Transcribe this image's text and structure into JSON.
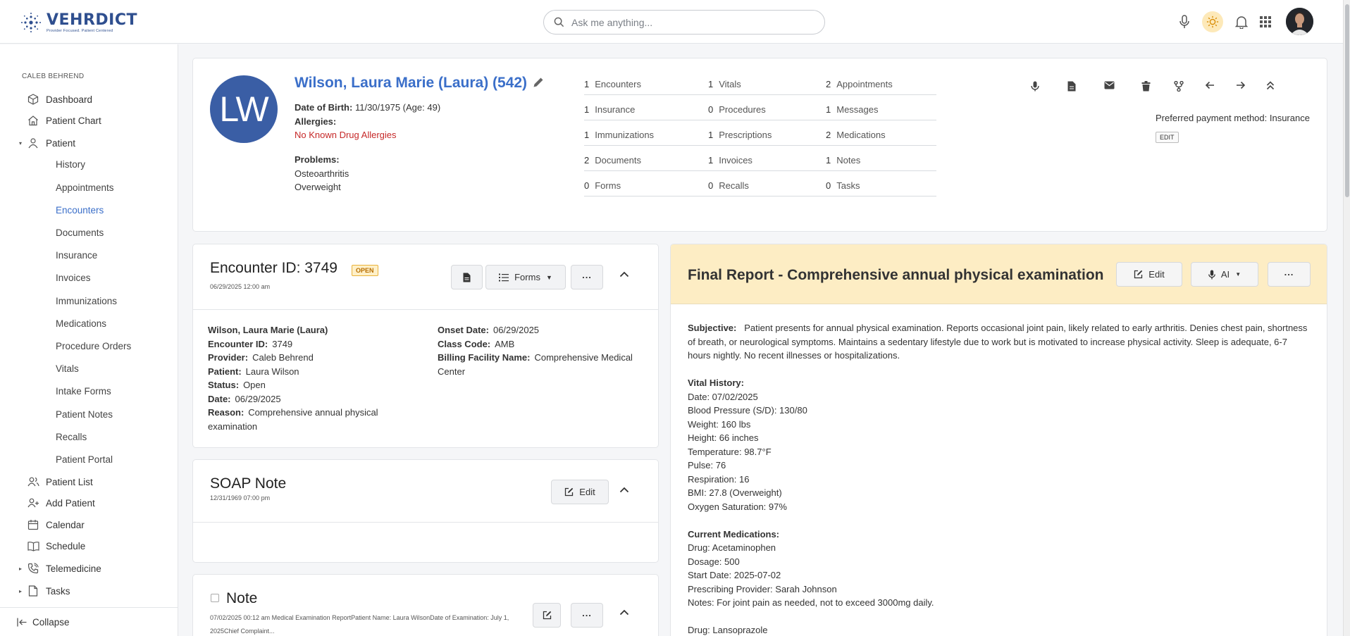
{
  "header": {
    "logo_name": "VEHRDICT",
    "logo_tagline": "Provider Focused. Patient Centered",
    "search_placeholder": "Ask me anything...",
    "icons": [
      "microphone-icon",
      "sun-icon",
      "bell-icon",
      "apps-grid-icon"
    ]
  },
  "sidebar": {
    "user": "CALEB BEHREND",
    "items": [
      {
        "label": "Dashboard",
        "icon": "cube-icon"
      },
      {
        "label": "Patient Chart",
        "icon": "home-icon"
      },
      {
        "label": "Patient",
        "icon": "user-icon"
      },
      {
        "label": "Patient List",
        "icon": "users-icon"
      },
      {
        "label": "Add Patient",
        "icon": "user-plus-icon"
      },
      {
        "label": "Calendar",
        "icon": "calendar-icon"
      },
      {
        "label": "Schedule",
        "icon": "book-icon"
      },
      {
        "label": "Telemedicine",
        "icon": "phone-icon"
      },
      {
        "label": "Tasks",
        "icon": "file-icon"
      }
    ],
    "patient_sub": [
      "History",
      "Appointments",
      "Encounters",
      "Documents",
      "Insurance",
      "Invoices",
      "Immunizations",
      "Medications",
      "Procedure Orders",
      "Vitals",
      "Intake Forms",
      "Patient Notes",
      "Recalls",
      "Patient Portal"
    ],
    "active_sub": "Encounters",
    "collapse_label": "Collapse"
  },
  "patient": {
    "initials": "LW",
    "name": "Wilson, Laura Marie (Laura) (542)",
    "dob_label": "Date of Birth:",
    "dob_value": "11/30/1975 (Age: 49)",
    "allergies_label": "Allergies:",
    "allergies_value": "No Known Drug Allergies",
    "problems_label": "Problems:",
    "problems": [
      "Osteoarthritis",
      "Overweight"
    ],
    "stats": [
      [
        {
          "n": "1",
          "label": "Encounters"
        },
        {
          "n": "1",
          "label": "Vitals"
        },
        {
          "n": "2",
          "label": "Appointments"
        }
      ],
      [
        {
          "n": "1",
          "label": "Insurance"
        },
        {
          "n": "0",
          "label": "Procedures"
        },
        {
          "n": "1",
          "label": "Messages"
        }
      ],
      [
        {
          "n": "1",
          "label": "Immunizations"
        },
        {
          "n": "1",
          "label": "Prescriptions"
        },
        {
          "n": "2",
          "label": "Medications"
        }
      ],
      [
        {
          "n": "2",
          "label": "Documents"
        },
        {
          "n": "1",
          "label": "Invoices"
        },
        {
          "n": "1",
          "label": "Notes"
        }
      ],
      [
        {
          "n": "0",
          "label": "Forms"
        },
        {
          "n": "0",
          "label": "Recalls"
        },
        {
          "n": "0",
          "label": "Tasks"
        }
      ]
    ],
    "preferred_payment": "Preferred payment method: Insurance",
    "edit_label": "EDIT",
    "action_icons": [
      "microphone-icon",
      "document-icon",
      "mail-icon",
      "trash-icon",
      "fork-icon",
      "arrow-left-icon",
      "arrow-right-icon",
      "collapse-up-icon"
    ]
  },
  "encounter": {
    "title": "Encounter ID: 3749",
    "status_badge": "OPEN",
    "datetime": "06/29/2025 12:00 am",
    "forms_label": "Forms",
    "more_label": "...",
    "patient_name": "Wilson, Laura Marie (Laura)",
    "left": [
      {
        "k": "Encounter ID:",
        "v": "3749"
      },
      {
        "k": "Provider:",
        "v": "Caleb Behrend"
      },
      {
        "k": "Patient:",
        "v": "Laura Wilson"
      },
      {
        "k": "Status:",
        "v": "Open"
      },
      {
        "k": "Date:",
        "v": "06/29/2025"
      },
      {
        "k": "Reason:",
        "v": "Comprehensive annual physical examination"
      }
    ],
    "right": [
      {
        "k": "Onset Date:",
        "v": "06/29/2025"
      },
      {
        "k": "Class Code:",
        "v": "AMB"
      },
      {
        "k": "Billing Facility Name:",
        "v": "Comprehensive Medical Center"
      }
    ]
  },
  "soap": {
    "title": "SOAP Note",
    "datetime": "12/31/1969 07:00 pm",
    "edit_label": "Edit"
  },
  "note": {
    "title": "Note",
    "meta": "07/02/2025 00:12 am Medical Examination ReportPatient Name: Laura WilsonDate of Examination: July 1, 2025Chief Complaint...",
    "more_label": "..."
  },
  "report": {
    "title": "Final Report - Comprehensive annual physical examination",
    "edit_label": "Edit",
    "ai_label": "AI",
    "more_label": "...",
    "subjective_label": "Subjective:",
    "subjective": "Patient presents for annual physical examination. Reports occasional joint pain, likely related to early arthritis. Denies chest pain, shortness of breath, or neurological symptoms. Maintains a sedentary lifestyle due to work but is motivated to increase physical activity. Sleep is adequate, 6-7 hours nightly. No recent illnesses or hospitalizations.",
    "vitals_label": "Vital History:",
    "vitals": [
      "Date: 07/02/2025",
      "Blood Pressure (S/D): 130/80",
      "Weight: 160 lbs",
      "Height: 66 inches",
      "Temperature: 98.7°F",
      "Pulse: 76",
      "Respiration: 16",
      "BMI: 27.8 (Overweight)",
      "Oxygen Saturation: 97%"
    ],
    "meds_label": "Current Medications:",
    "med1": [
      "Drug: Acetaminophen",
      "Dosage: 500",
      "Start Date: 2025-07-02",
      "Prescribing Provider: Sarah Johnson",
      "Notes: For joint pain as needed, not to exceed 3000mg daily."
    ],
    "med2": [
      "Drug: Lansoprazole"
    ]
  }
}
